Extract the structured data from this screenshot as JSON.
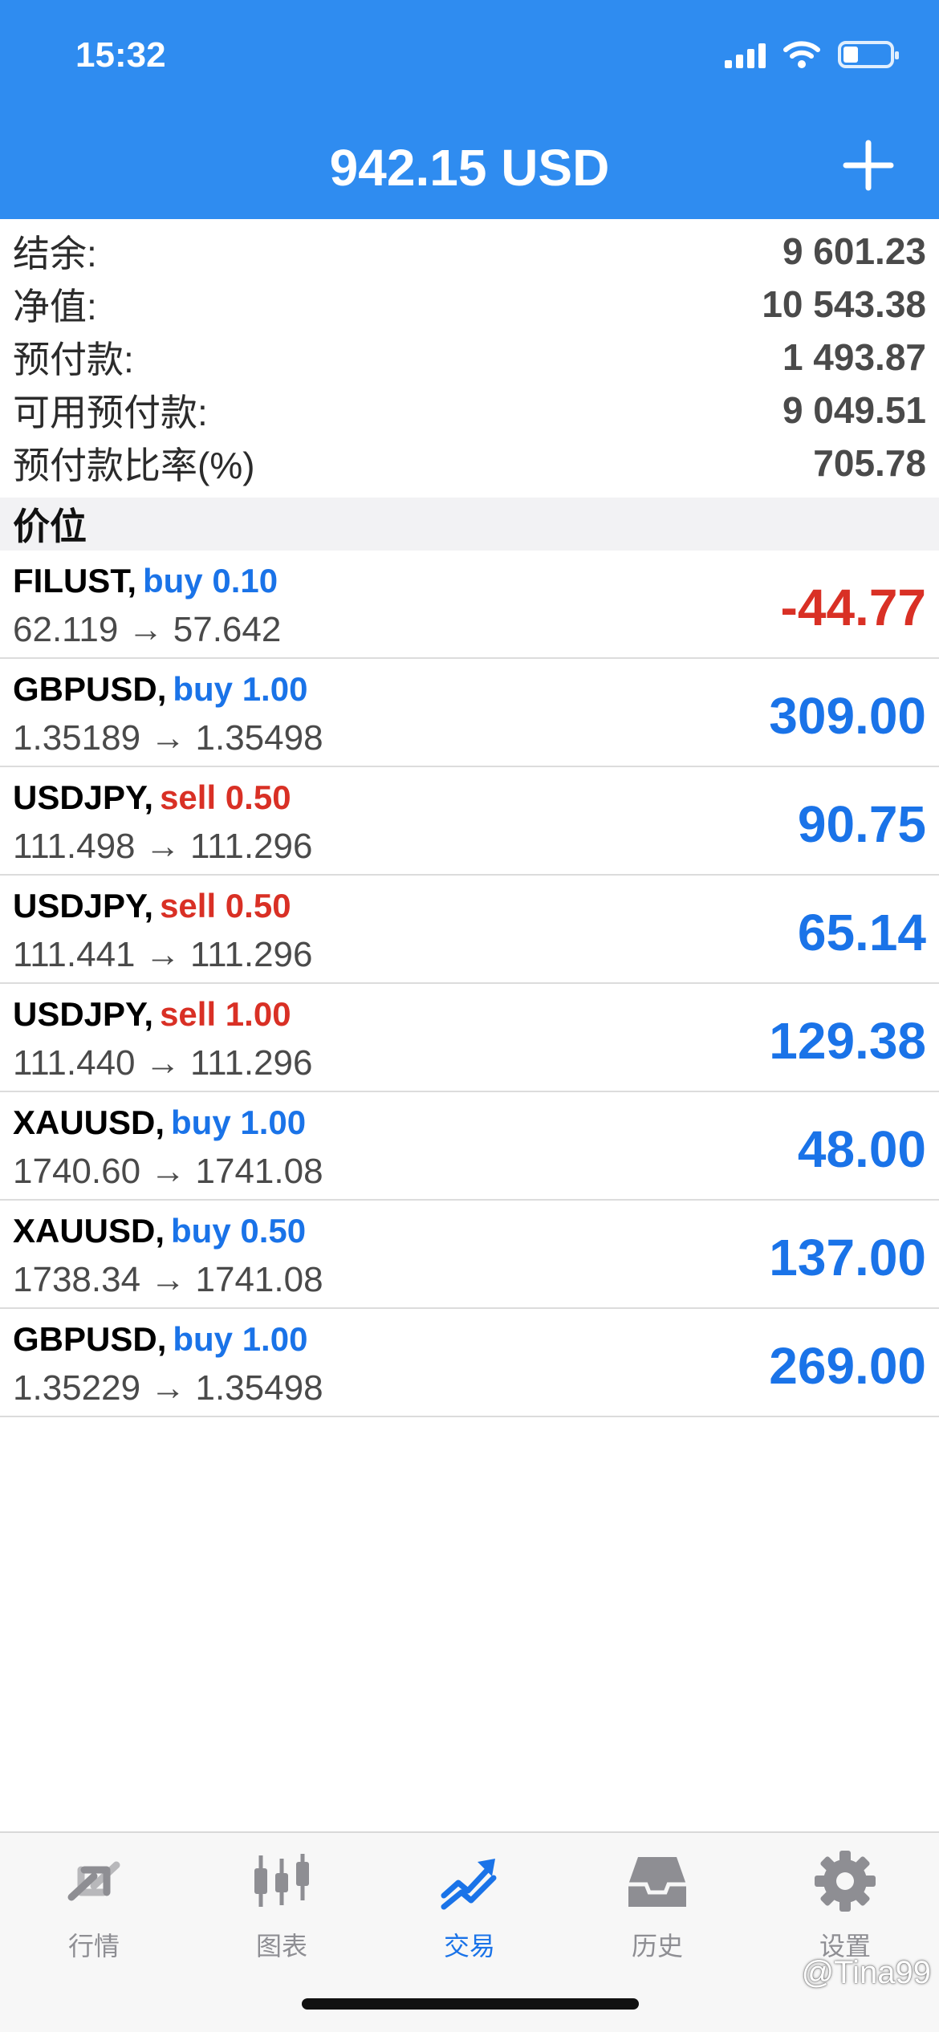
{
  "status_bar": {
    "time": "15:32"
  },
  "header": {
    "title": "942.15 USD"
  },
  "summary": [
    {
      "label": "结余:",
      "value": "9 601.23"
    },
    {
      "label": "净值:",
      "value": "10 543.38"
    },
    {
      "label": "预付款:",
      "value": "1 493.87"
    },
    {
      "label": "可用预付款:",
      "value": "9 049.51"
    },
    {
      "label": "预付款比率(%)",
      "value": "705.78"
    }
  ],
  "section_title": "价位",
  "positions": [
    {
      "symbol": "FILUST,",
      "side": "buy 0.10",
      "prices": "62.119 → 57.642",
      "profit": "-44.77"
    },
    {
      "symbol": "GBPUSD,",
      "side": "buy 1.00",
      "prices": "1.35189 → 1.35498",
      "profit": "309.00"
    },
    {
      "symbol": "USDJPY,",
      "side": "sell 0.50",
      "prices": "111.498 → 111.296",
      "profit": "90.75"
    },
    {
      "symbol": "USDJPY,",
      "side": "sell 0.50",
      "prices": "111.441 → 111.296",
      "profit": "65.14"
    },
    {
      "symbol": "USDJPY,",
      "side": "sell 1.00",
      "prices": "111.440 → 111.296",
      "profit": "129.38"
    },
    {
      "symbol": "XAUUSD,",
      "side": "buy 1.00",
      "prices": "1740.60 → 1741.08",
      "profit": "48.00"
    },
    {
      "symbol": "XAUUSD,",
      "side": "buy 0.50",
      "prices": "1738.34 → 1741.08",
      "profit": "137.00"
    },
    {
      "symbol": "GBPUSD,",
      "side": "buy 1.00",
      "prices": "1.35229 → 1.35498",
      "profit": "269.00"
    }
  ],
  "tabs": [
    {
      "label": "行情",
      "icon": "quotes-icon"
    },
    {
      "label": "图表",
      "icon": "chart-icon"
    },
    {
      "label": "交易",
      "icon": "trade-icon",
      "active": true
    },
    {
      "label": "历史",
      "icon": "history-icon"
    },
    {
      "label": "设置",
      "icon": "settings-icon"
    }
  ],
  "watermark": "@Tina99",
  "colors": {
    "header_bg": "#2f8cf0",
    "buy": "#1a73e8",
    "sell": "#d93025",
    "tab_inactive": "#8e8e93"
  }
}
